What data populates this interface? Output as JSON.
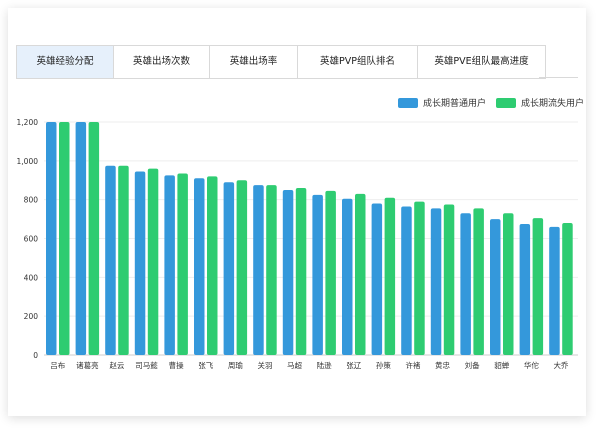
{
  "tabs": [
    {
      "label": "英雄经验分配",
      "active": true
    },
    {
      "label": "英雄出场次数",
      "active": false
    },
    {
      "label": "英雄出场率",
      "active": false
    },
    {
      "label": "英雄PVP组队排名",
      "active": false
    },
    {
      "label": "英雄PVE组队最高进度",
      "active": false
    }
  ],
  "colors": {
    "series1": "#3498db",
    "series2": "#2ecc71"
  },
  "chart_data": {
    "type": "bar",
    "categories": [
      "吕布",
      "诸葛亮",
      "赵云",
      "司马懿",
      "曹操",
      "张飞",
      "周瑜",
      "关羽",
      "马超",
      "陆逊",
      "张辽",
      "孙策",
      "许褚",
      "黄忠",
      "刘备",
      "貂蝉",
      "华佗",
      "大乔"
    ],
    "series": [
      {
        "name": "成长期普通用户",
        "values": [
          1200,
          1200,
          975,
          945,
          925,
          910,
          890,
          875,
          850,
          825,
          805,
          780,
          765,
          755,
          730,
          700,
          675,
          660
        ]
      },
      {
        "name": "成长期流失用户",
        "values": [
          1200,
          1200,
          975,
          960,
          935,
          920,
          900,
          875,
          860,
          845,
          830,
          810,
          790,
          775,
          755,
          730,
          705,
          680
        ]
      }
    ],
    "yticks": [
      "0",
      "200",
      "400",
      "600",
      "800",
      "1,000",
      "1,200"
    ],
    "ylim": [
      0,
      1200
    ],
    "legend": "top-right",
    "grid": true
  }
}
